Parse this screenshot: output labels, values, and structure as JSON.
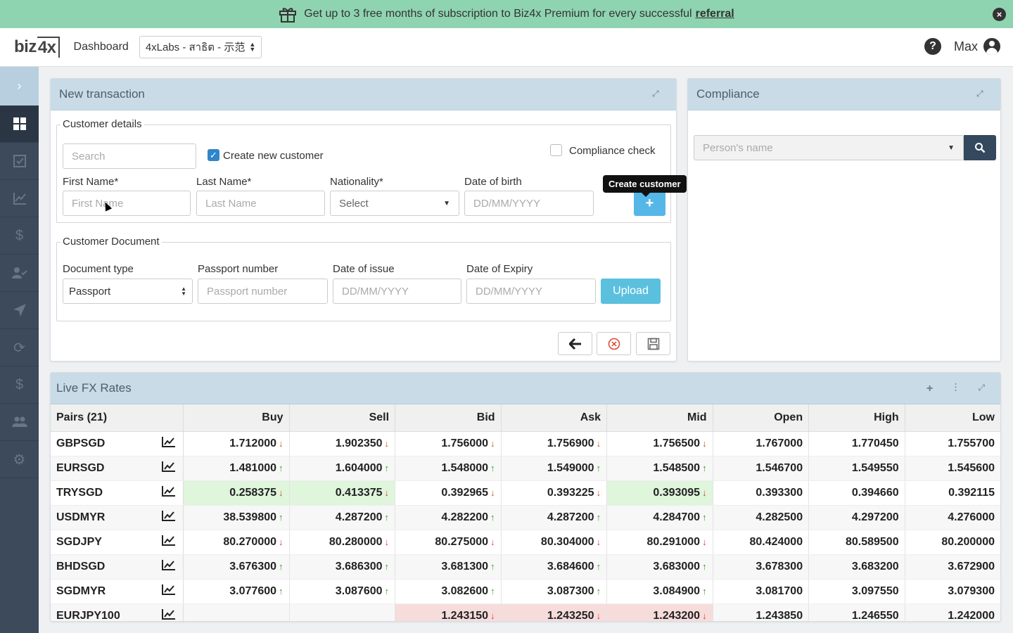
{
  "banner": {
    "text": "Get up to 3 free months of subscription to Biz4x Premium for every successful",
    "link": "referral",
    "close_icon": "close-icon"
  },
  "topbar": {
    "logo": "biz",
    "logo_box": "4x",
    "nav": "Dashboard",
    "company": "4xLabs - สาธิต - 示范",
    "user": "Max"
  },
  "sidebar": {
    "icons": [
      "dashboard-icon",
      "checklist-icon",
      "chart-icon",
      "dollar-icon",
      "user-check-icon",
      "send-icon",
      "refresh-icon",
      "dollar-icon",
      "users-icon",
      "gear-icon"
    ]
  },
  "new_transaction": {
    "title": "New transaction",
    "customer_details": {
      "legend": "Customer details",
      "search_placeholder": "Search",
      "create_new_label": "Create new customer",
      "compliance_label": "Compliance check",
      "first_name_label": "First Name*",
      "first_name_placeholder": "First Name",
      "last_name_label": "Last Name*",
      "last_name_placeholder": "Last Name",
      "nationality_label": "Nationality*",
      "nationality_value": "Select",
      "dob_label": "Date of birth",
      "dob_placeholder": "DD/MM/YYYY",
      "tooltip": "Create customer",
      "plus": "+"
    },
    "customer_document": {
      "legend": "Customer Document",
      "doc_type_label": "Document type",
      "doc_type_value": "Passport",
      "passport_label": "Passport number",
      "passport_placeholder": "Passport number",
      "issue_label": "Date of issue",
      "issue_placeholder": "DD/MM/YYYY",
      "expiry_label": "Date of Expiry",
      "expiry_placeholder": "DD/MM/YYYY",
      "upload": "Upload"
    }
  },
  "compliance": {
    "title": "Compliance",
    "placeholder": "Person's name"
  },
  "fx": {
    "title": "Live FX Rates",
    "headers": [
      "Pairs (21)",
      "Buy",
      "Sell",
      "Bid",
      "Ask",
      "Mid",
      "Open",
      "High",
      "Low"
    ],
    "rows": [
      {
        "pair": "GBPSGD",
        "buy": "1.712000",
        "buy_d": "dn",
        "sell": "1.902350",
        "sell_d": "dn",
        "bid": "1.756000",
        "bid_d": "dn",
        "ask": "1.756900",
        "ask_d": "dn",
        "mid": "1.756500",
        "mid_d": "dn",
        "open": "1.767000",
        "high": "1.770450",
        "low": "1.755700"
      },
      {
        "pair": "EURSGD",
        "buy": "1.481000",
        "buy_d": "up",
        "sell": "1.604000",
        "sell_d": "up",
        "bid": "1.548000",
        "bid_d": "up",
        "ask": "1.549000",
        "ask_d": "up",
        "mid": "1.548500",
        "mid_d": "up",
        "open": "1.546700",
        "high": "1.549550",
        "low": "1.545600"
      },
      {
        "pair": "TRYSGD",
        "buy": "0.258375",
        "buy_d": "dn",
        "sell": "0.413375",
        "sell_d": "dn",
        "bid": "0.392965",
        "bid_d": "dn",
        "ask": "0.393225",
        "ask_d": "dn",
        "mid": "0.393095",
        "mid_d": "dn",
        "open": "0.393300",
        "high": "0.394660",
        "low": "0.392115",
        "hl": "green"
      },
      {
        "pair": "USDMYR",
        "buy": "38.539800",
        "buy_d": "up",
        "sell": "4.287200",
        "sell_d": "up",
        "bid": "4.282200",
        "bid_d": "up",
        "ask": "4.287200",
        "ask_d": "up",
        "mid": "4.284700",
        "mid_d": "up",
        "open": "4.282500",
        "high": "4.297200",
        "low": "4.276000"
      },
      {
        "pair": "SGDJPY",
        "buy": "80.270000",
        "buy_d": "dn",
        "sell": "80.280000",
        "sell_d": "dn",
        "bid": "80.275000",
        "bid_d": "dn",
        "ask": "80.304000",
        "ask_d": "dn",
        "mid": "80.291000",
        "mid_d": "dn",
        "open": "80.424000",
        "high": "80.589500",
        "low": "80.200000"
      },
      {
        "pair": "BHDSGD",
        "buy": "3.676300",
        "buy_d": "up",
        "sell": "3.686300",
        "sell_d": "up",
        "bid": "3.681300",
        "bid_d": "up",
        "ask": "3.684600",
        "ask_d": "up",
        "mid": "3.683000",
        "mid_d": "up",
        "open": "3.678300",
        "high": "3.683200",
        "low": "3.672900"
      },
      {
        "pair": "SGDMYR",
        "buy": "3.077600",
        "buy_d": "up",
        "sell": "3.087600",
        "sell_d": "up",
        "bid": "3.082600",
        "bid_d": "up",
        "ask": "3.087300",
        "ask_d": "up",
        "mid": "3.084900",
        "mid_d": "up",
        "open": "3.081700",
        "high": "3.097550",
        "low": "3.079300"
      },
      {
        "pair": "EURJPY100",
        "buy": "",
        "buy_d": "",
        "sell": "",
        "sell_d": "",
        "bid": "1.243150",
        "bid_d": "dn",
        "ask": "1.243250",
        "ask_d": "dn",
        "mid": "1.243200",
        "mid_d": "dn",
        "open": "1.243850",
        "high": "1.246550",
        "low": "1.242000",
        "hl": "red"
      }
    ]
  }
}
